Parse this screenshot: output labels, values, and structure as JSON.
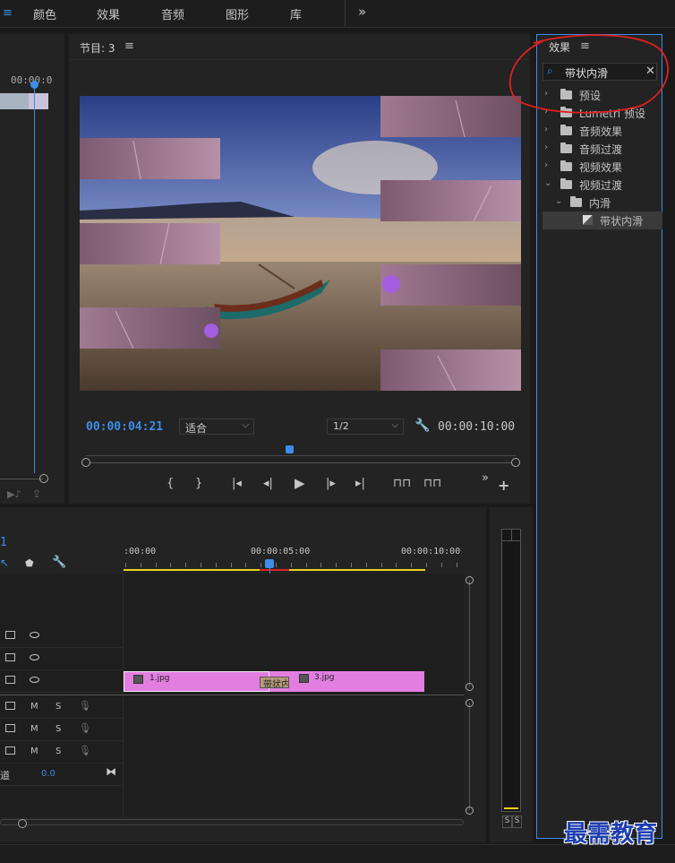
{
  "topbar": {
    "tabs": [
      "颜色",
      "效果",
      "音频",
      "图形",
      "库"
    ],
    "more": "»"
  },
  "source_panel": {
    "timecode": "00:00:0"
  },
  "program": {
    "title": "节目: 3",
    "timecode": "00:00:04:21",
    "fit": "适合",
    "resolution": "1/2",
    "duration": "00:00:10:00"
  },
  "effects": {
    "title": "效果",
    "search_value": "带状内滑",
    "tree": [
      {
        "label": "预设"
      },
      {
        "label": "Lumetri 预设"
      },
      {
        "label": "音频效果"
      },
      {
        "label": "音频过渡"
      },
      {
        "label": "视频效果"
      },
      {
        "label": "视频过渡"
      },
      {
        "label": "内滑"
      },
      {
        "label": "带状内滑"
      }
    ]
  },
  "timeline": {
    "seq_number": "1",
    "time_start": ":00:00",
    "time_mid": "00:00:05:00",
    "time_end": "00:00:10:00",
    "clip1": "1.jpg",
    "clip2": "3.jpg",
    "transition": "带状内",
    "master_label": "道",
    "master_value": "0.0",
    "m_label": "M",
    "s_label": "S"
  },
  "meter": {
    "s1": "S",
    "s2": "S"
  },
  "watermark": "最需教育",
  "colors": {
    "accent_blue": "#3d8de8",
    "clip_pink": "#e17ee0",
    "annotation_red": "#e02020",
    "work_area_yellow": "#e8d21d"
  }
}
